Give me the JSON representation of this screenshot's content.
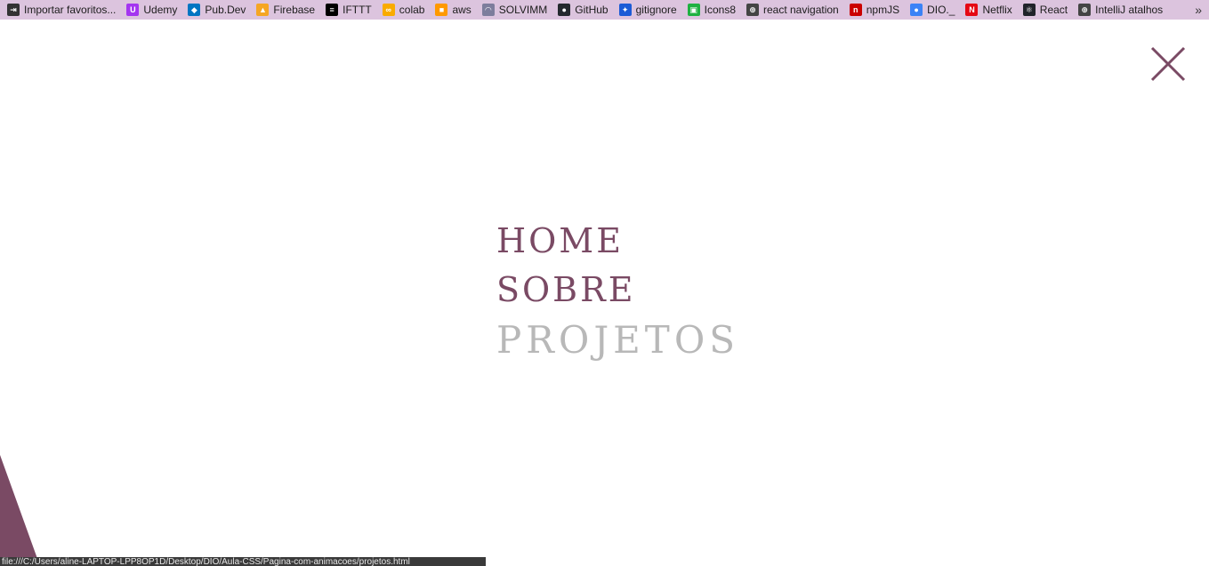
{
  "bookmarks": [
    {
      "label": "Importar favoritos...",
      "icon": "import-icon",
      "color": "#333333",
      "glyph": "⇥"
    },
    {
      "label": "Udemy",
      "icon": "udemy-icon",
      "color": "#a435f0",
      "glyph": "U"
    },
    {
      "label": "Pub.Dev",
      "icon": "pubdev-icon",
      "color": "#0175c2",
      "glyph": "◆"
    },
    {
      "label": "Firebase",
      "icon": "firebase-icon",
      "color": "#f5a623",
      "glyph": "▲"
    },
    {
      "label": "IFTTT",
      "icon": "ifttt-icon",
      "color": "#000000",
      "glyph": "≡"
    },
    {
      "label": "colab",
      "icon": "colab-icon",
      "color": "#f9ab00",
      "glyph": "∞"
    },
    {
      "label": "aws",
      "icon": "aws-icon",
      "color": "#ff9900",
      "glyph": "■"
    },
    {
      "label": "SOLVIMM",
      "icon": "solvimm-icon",
      "color": "#7d7d9c",
      "glyph": "◠"
    },
    {
      "label": "GitHub",
      "icon": "github-icon",
      "color": "#24292e",
      "glyph": "●"
    },
    {
      "label": "gitignore",
      "icon": "gitignore-icon",
      "color": "#1b5bd6",
      "glyph": "✦"
    },
    {
      "label": "Icons8",
      "icon": "icons8-icon",
      "color": "#1fb141",
      "glyph": "▣"
    },
    {
      "label": "react navigation",
      "icon": "globe-icon",
      "color": "#444444",
      "glyph": "⊕"
    },
    {
      "label": "npmJS",
      "icon": "npm-icon",
      "color": "#cb0000",
      "glyph": "n"
    },
    {
      "label": "DIO._",
      "icon": "dio-icon",
      "color": "#3b82f6",
      "glyph": "●"
    },
    {
      "label": "Netflix",
      "icon": "netflix-icon",
      "color": "#e50914",
      "glyph": "N"
    },
    {
      "label": "React",
      "icon": "react-icon",
      "color": "#20232a",
      "glyph": "⚛"
    },
    {
      "label": "IntelliJ atalhos",
      "icon": "globe-icon",
      "color": "#444444",
      "glyph": "⊕"
    }
  ],
  "overflow_glyph": "»",
  "menu": {
    "home": "HOME",
    "sobre": "SOBRE",
    "projetos": "PROJETOS"
  },
  "colors": {
    "accent": "#7a4a64",
    "inactive": "#b8b8b8",
    "bookmarks_bar": "#dcc4de"
  },
  "status_url": "file:///C:/Users/aline-LAPTOP-LPP8OP1D/Desktop/DIO/Aula-CSS/Pagina-com-animacoes/projetos.html"
}
